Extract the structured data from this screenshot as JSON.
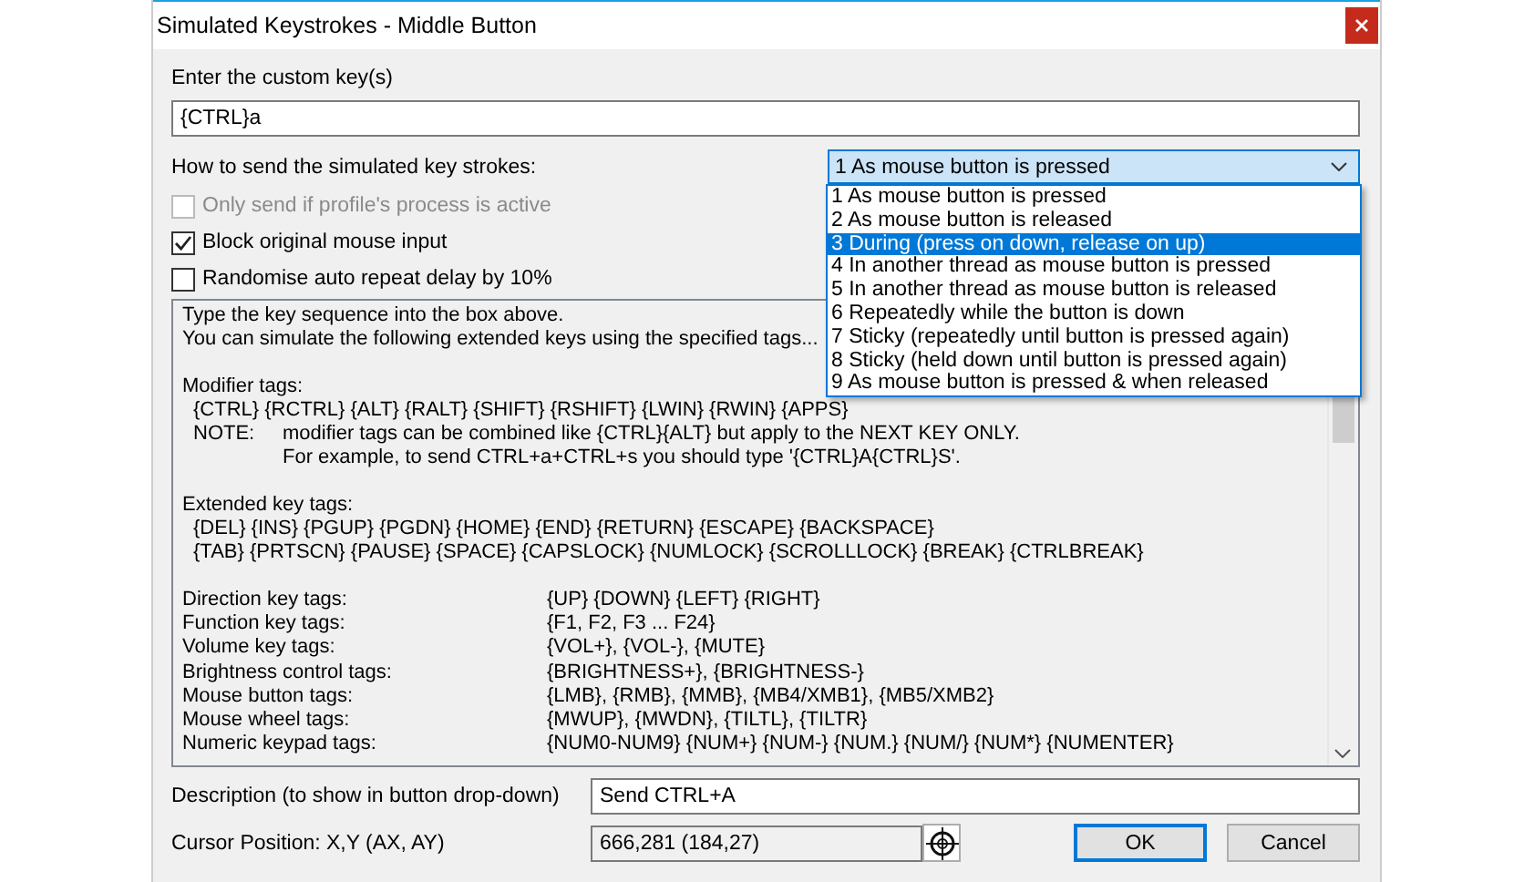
{
  "window": {
    "title": "Simulated Keystrokes - Middle Button"
  },
  "custom_key": {
    "label": "Enter the custom key(s)",
    "value": "{CTRL}a"
  },
  "send_mode": {
    "label": "How to send the simulated key strokes:",
    "value": "1 As mouse button is pressed",
    "expanded": true,
    "options": [
      {
        "label": "1 As mouse button is pressed",
        "highlighted": false
      },
      {
        "label": "2 As mouse button is released",
        "highlighted": false
      },
      {
        "label": "3 During (press on down, release on up)",
        "highlighted": true
      },
      {
        "label": "4 In another thread as mouse button is pressed",
        "highlighted": false
      },
      {
        "label": "5 In another thread as mouse button is released",
        "highlighted": false
      },
      {
        "label": "6 Repeatedly while the button is down",
        "highlighted": false
      },
      {
        "label": "7 Sticky (repeatedly until button is pressed again)",
        "highlighted": false
      },
      {
        "label": "8 Sticky (held down until button is pressed again)",
        "highlighted": false
      },
      {
        "label": "9 As mouse button is pressed & when released",
        "highlighted": false
      }
    ]
  },
  "options": [
    {
      "label": "Only send if profile's process is active",
      "checked": false,
      "disabled": true
    },
    {
      "label": "Block original mouse input",
      "checked": true,
      "disabled": false
    },
    {
      "label": "Randomise auto repeat delay by 10%",
      "checked": false,
      "disabled": false
    }
  ],
  "help": {
    "intro": [
      "Type the key sequence into the box above.",
      "You can simulate the following extended keys using the specified tags..."
    ],
    "modifier_heading": "Modifier tags:",
    "modifier_tags": "{CTRL} {RCTRL} {ALT} {RALT} {SHIFT} {RSHIFT} {LWIN} {RWIN} {APPS}",
    "note_label": "NOTE:",
    "note_lines": [
      "modifier tags can be combined like {CTRL}{ALT} but apply to the NEXT KEY ONLY.",
      "For example, to send CTRL+a+CTRL+s you should type '{CTRL}A{CTRL}S'."
    ],
    "extended_heading": "Extended key tags:",
    "extended_tags": [
      "{DEL} {INS} {PGUP} {PGDN} {HOME} {END} {RETURN} {ESCAPE} {BACKSPACE}",
      "{TAB} {PRTSCN} {PAUSE} {SPACE} {CAPSLOCK} {NUMLOCK} {SCROLLLOCK} {BREAK} {CTRLBREAK}"
    ],
    "tag_rows": [
      {
        "label": "Direction key tags:",
        "value": "{UP} {DOWN} {LEFT} {RIGHT}"
      },
      {
        "label": "Function key tags:",
        "value": "{F1, F2, F3 ... F24}"
      },
      {
        "label": "Volume key tags:",
        "value": "{VOL+}, {VOL-}, {MUTE}"
      },
      {
        "label": "Brightness control tags:",
        "value": "{BRIGHTNESS+}, {BRIGHTNESS-}"
      },
      {
        "label": "Mouse button tags:",
        "value": "{LMB}, {RMB}, {MMB}, {MB4/XMB1}, {MB5/XMB2}"
      },
      {
        "label": "Mouse wheel tags:",
        "value": "{MWUP}, {MWDN}, {TILTL}, {TILTR}"
      },
      {
        "label": "Numeric keypad tags:",
        "value": "{NUM0-NUM9} {NUM+} {NUM-} {NUM.} {NUM/} {NUM*} {NUMENTER}"
      }
    ]
  },
  "description": {
    "label": "Description (to show in button drop-down)",
    "value": "Send CTRL+A"
  },
  "cursor": {
    "label": "Cursor Position: X,Y (AX, AY)",
    "value": "666,281 (184,27)"
  },
  "buttons": [
    {
      "label": "OK",
      "kind": "default"
    },
    {
      "label": "Cancel",
      "kind": "normal"
    }
  ]
}
